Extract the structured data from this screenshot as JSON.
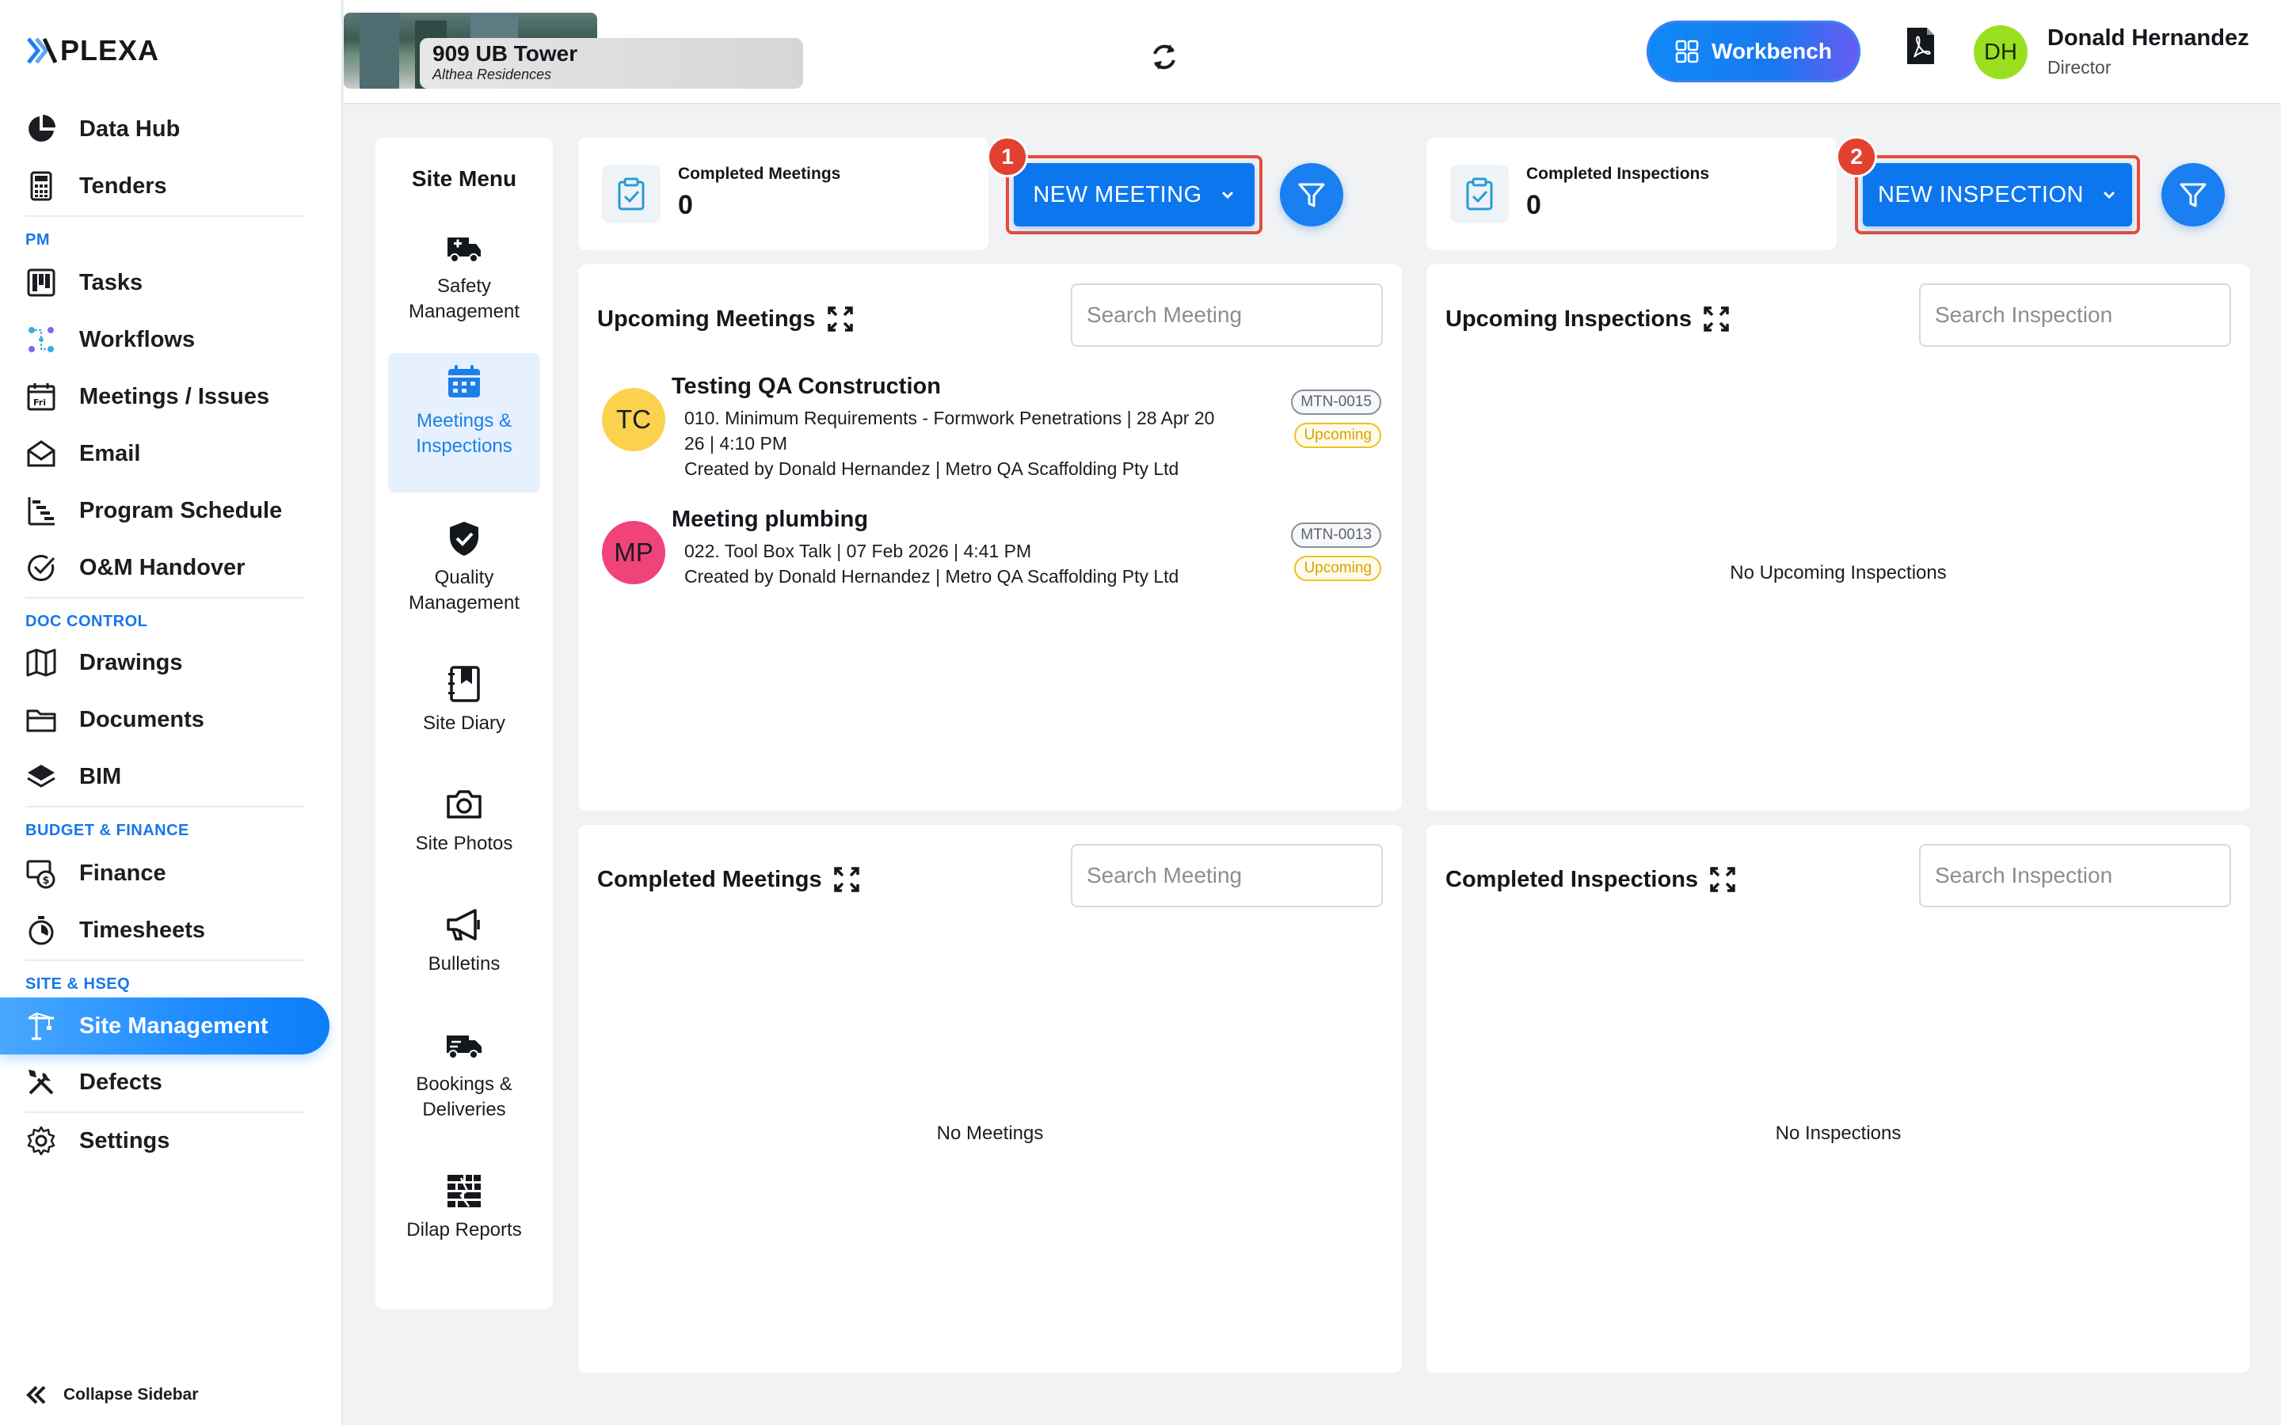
{
  "brand": {
    "logo_text": "PLEXA"
  },
  "sidebar": {
    "items_top": [
      {
        "label": "Data Hub",
        "icon": "pie-chart-icon"
      },
      {
        "label": "Tenders",
        "icon": "calculator-icon"
      }
    ],
    "section_pm": "PM",
    "items_pm": [
      {
        "label": "Tasks",
        "icon": "kanban-icon"
      },
      {
        "label": "Workflows",
        "icon": "workflow-icon"
      },
      {
        "label": "Meetings / Issues",
        "icon": "calendar-icon"
      },
      {
        "label": "Email",
        "icon": "envelope-icon"
      },
      {
        "label": "Program Schedule",
        "icon": "gantt-icon"
      },
      {
        "label": "O&M Handover",
        "icon": "check-circle-icon"
      }
    ],
    "section_doc": "DOC CONTROL",
    "items_doc": [
      {
        "label": "Drawings",
        "icon": "map-icon"
      },
      {
        "label": "Documents",
        "icon": "folder-icon"
      },
      {
        "label": "BIM",
        "icon": "layers-icon"
      }
    ],
    "section_budget": "BUDGET & FINANCE",
    "items_budget": [
      {
        "label": "Finance",
        "icon": "money-icon"
      },
      {
        "label": "Timesheets",
        "icon": "stopwatch-icon"
      }
    ],
    "section_site": "SITE & HSEQ",
    "items_site": [
      {
        "label": "Site Management",
        "icon": "crane-icon",
        "active": true
      },
      {
        "label": "Defects",
        "icon": "tools-icon"
      },
      {
        "label": "Settings",
        "icon": "gear-icon"
      }
    ],
    "collapse_label": "Collapse Sidebar"
  },
  "topbar": {
    "project_title": "909 UB Tower",
    "project_subtitle": "Althea Residences",
    "workbench_label": "Workbench",
    "user_initials": "DH",
    "user_name": "Donald Hernandez",
    "user_role": "Director"
  },
  "site_menu": {
    "title": "Site Menu",
    "items": [
      {
        "label": "Safety Management",
        "icon": "ambulance-icon"
      },
      {
        "label": "Meetings & Inspections",
        "icon": "calendar-icon",
        "active": true
      },
      {
        "label": "Quality Management",
        "icon": "shield-check-icon"
      },
      {
        "label": "Site Diary",
        "icon": "diary-icon"
      },
      {
        "label": "Site Photos",
        "icon": "camera-icon"
      },
      {
        "label": "Bulletins",
        "icon": "megaphone-icon"
      },
      {
        "label": "Bookings & Deliveries",
        "icon": "truck-icon"
      },
      {
        "label": "Dilap Reports",
        "icon": "brick-wall-icon"
      }
    ]
  },
  "meetings": {
    "completed_label": "Completed Meetings",
    "completed_count": "0",
    "new_button": "NEW MEETING",
    "step_badge": "1",
    "upcoming_title": "Upcoming Meetings",
    "search_placeholder": "Search Meeting",
    "upcoming": [
      {
        "initials": "TC",
        "avatar_color": "#fbd24e",
        "title": "Testing QA Construction",
        "line1": "010. Minimum Requirements - Formwork Penetrations | 28 Apr 20",
        "line2": "26 | 4:10 PM",
        "line3": "Created by Donald Hernandez | Metro QA Scaffolding Pty Ltd",
        "code": "MTN-0015",
        "status": "Upcoming"
      },
      {
        "initials": "MP",
        "avatar_color": "#f0437a",
        "title": "Meeting plumbing",
        "line1": "022. Tool Box Talk | 07 Feb 2026 | 4:41 PM",
        "line2": "Created by Donald Hernandez | Metro QA Scaffolding Pty Ltd",
        "code": "MTN-0013",
        "status": "Upcoming"
      }
    ],
    "completed_title": "Completed Meetings",
    "completed_empty": "No Meetings"
  },
  "inspections": {
    "completed_label": "Completed Inspections",
    "completed_count": "0",
    "new_button": "NEW INSPECTION",
    "step_badge": "2",
    "upcoming_title": "Upcoming Inspections",
    "search_placeholder": "Search Inspection",
    "upcoming_empty": "No Upcoming Inspections",
    "completed_title": "Completed Inspections",
    "completed_empty": "No Inspections"
  },
  "colors": {
    "accent": "#0c76ef",
    "highlight_border": "#e84b3c",
    "upcoming": "#f0c020"
  }
}
